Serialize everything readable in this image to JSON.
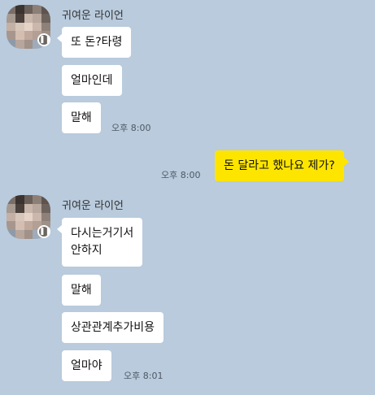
{
  "sender": {
    "name": "귀여운 라이언"
  },
  "messages": [
    {
      "text": "또 돈?타령"
    },
    {
      "text": "얼마인데"
    },
    {
      "text": "말해",
      "time": "오후 8:00"
    },
    {
      "text": "돈 달라고 했나요 제가?",
      "time": "오후 8:00"
    },
    {
      "text_line1": "다시는거기서",
      "text_line2": "안하지"
    },
    {
      "text": "말해"
    },
    {
      "text": "상관관계추가비용"
    },
    {
      "text": "얼마야",
      "time": "오후 8:01"
    }
  ],
  "colors": {
    "background": "#b9cbdd",
    "my_bubble": "#fee500",
    "their_bubble": "#ffffff"
  }
}
